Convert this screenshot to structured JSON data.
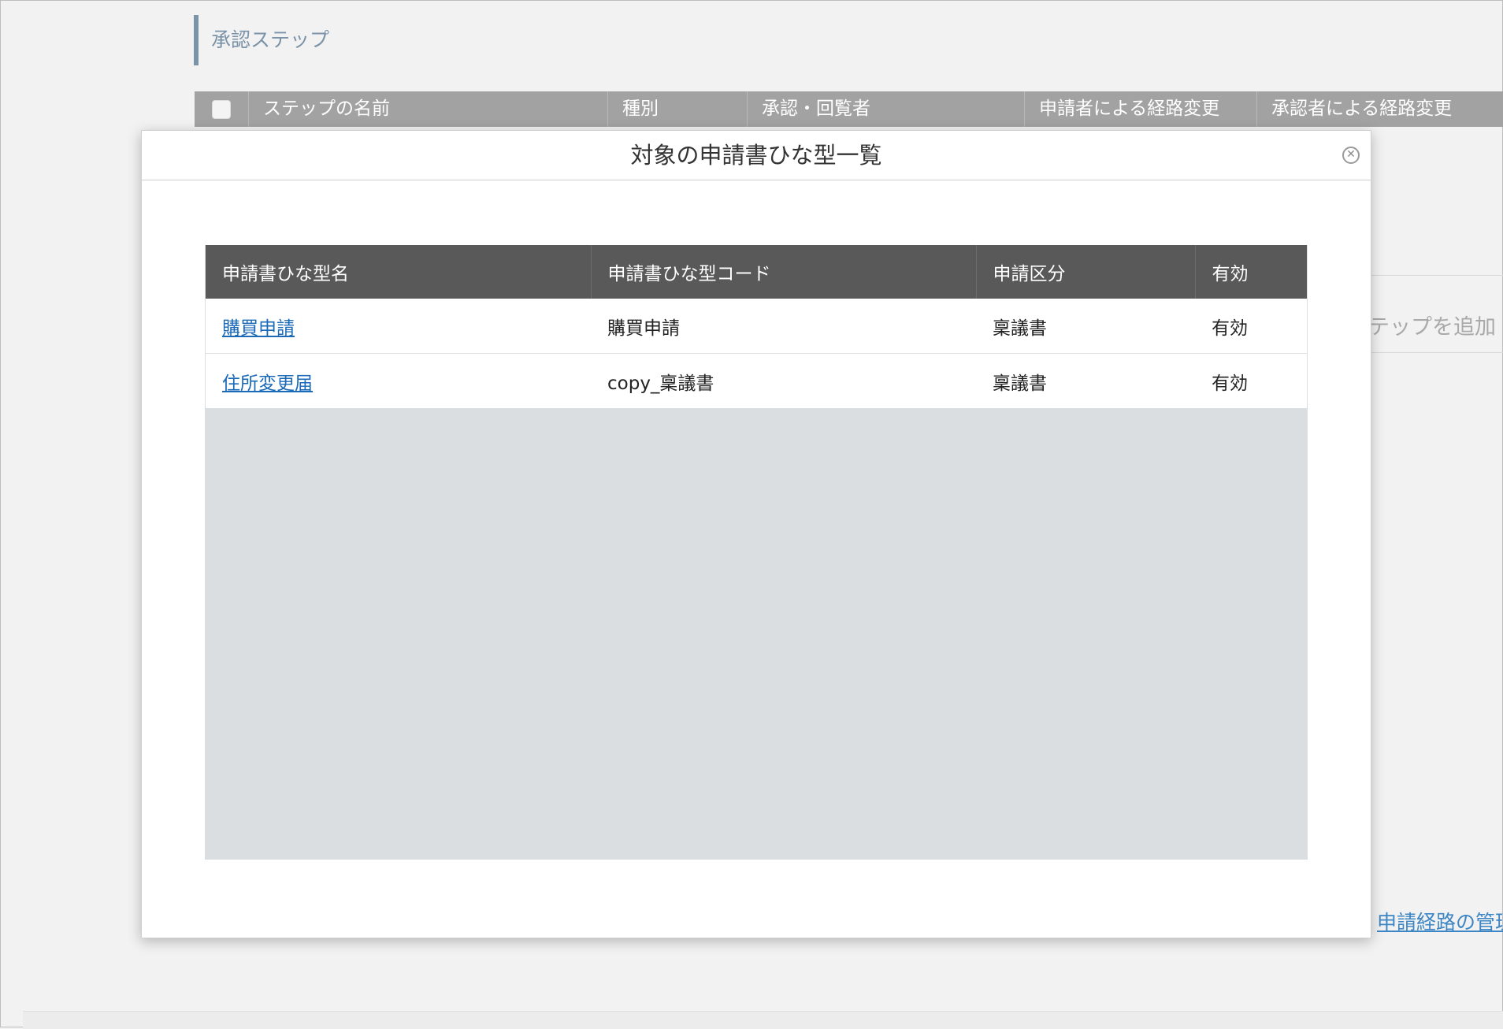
{
  "background": {
    "section_title": "承認ステップ",
    "table_headers": [
      "ステップの名前",
      "種別",
      "承認・回覧者",
      "申請者による経路変更",
      "承認者による経路変更"
    ],
    "add_step_text": "テップを追加",
    "route_link_text": "申請経路の管理"
  },
  "modal": {
    "title": "対象の申請書ひな型一覧",
    "columns": [
      "申請書ひな型名",
      "申請書ひな型コード",
      "申請区分",
      "有効"
    ],
    "rows": [
      {
        "name": "購買申請",
        "code": "購買申請",
        "category": "稟議書",
        "status": "有効"
      },
      {
        "name": "住所変更届",
        "code": "copy_稟議書",
        "category": "稟議書",
        "status": "有効"
      }
    ]
  },
  "colors": {
    "status_valid": "#1e8a2e",
    "link": "#1a6ab8",
    "header_bg": "#595959"
  }
}
